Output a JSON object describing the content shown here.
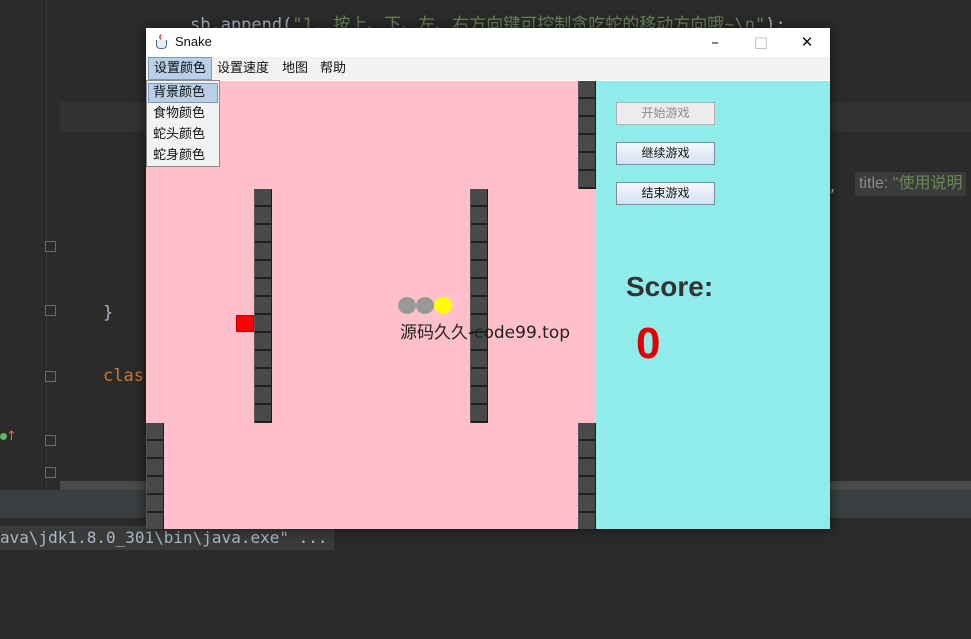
{
  "ide": {
    "code_top_prefix": "sb.append(",
    "code_top_string": "\"1. 按上、下、左、右方向键可控制贪吃蛇的移动方向哦~\\n\"",
    "code_top_suffix": ");",
    "code_brace": "}",
    "code_class": "clas",
    "hint_comma": ",",
    "hint_label": "title:",
    "hint_string": "\"使用说明",
    "console_line": "ava\\jdk1.8.0_301\\bin\\java.exe\" ..."
  },
  "window": {
    "title": "Snake",
    "controls": {
      "minimize": "–",
      "maximize": "□",
      "close": "✕"
    }
  },
  "menubar": {
    "items": [
      {
        "label": "设置颜色",
        "open": true
      },
      {
        "label": "设置速度"
      },
      {
        "label": "地图"
      },
      {
        "label": "帮助"
      }
    ],
    "dropdown": [
      {
        "label": "背景颜色",
        "selected": true
      },
      {
        "label": "食物颜色"
      },
      {
        "label": "蛇头颜色"
      },
      {
        "label": "蛇身颜色"
      }
    ]
  },
  "game": {
    "background_color": "#ffc0cb",
    "food_color": "#ff0000",
    "snake_head_color": "#ffff00",
    "snake_body_color": "#999999",
    "watermark": "源码久久-code99.top"
  },
  "panel": {
    "background_color": "#8fecea",
    "buttons": [
      {
        "label": "开始游戏",
        "enabled": false
      },
      {
        "label": "继续游戏",
        "enabled": true
      },
      {
        "label": "结束游戏",
        "enabled": true
      }
    ],
    "score_label": "Score:",
    "score_value": "0"
  }
}
